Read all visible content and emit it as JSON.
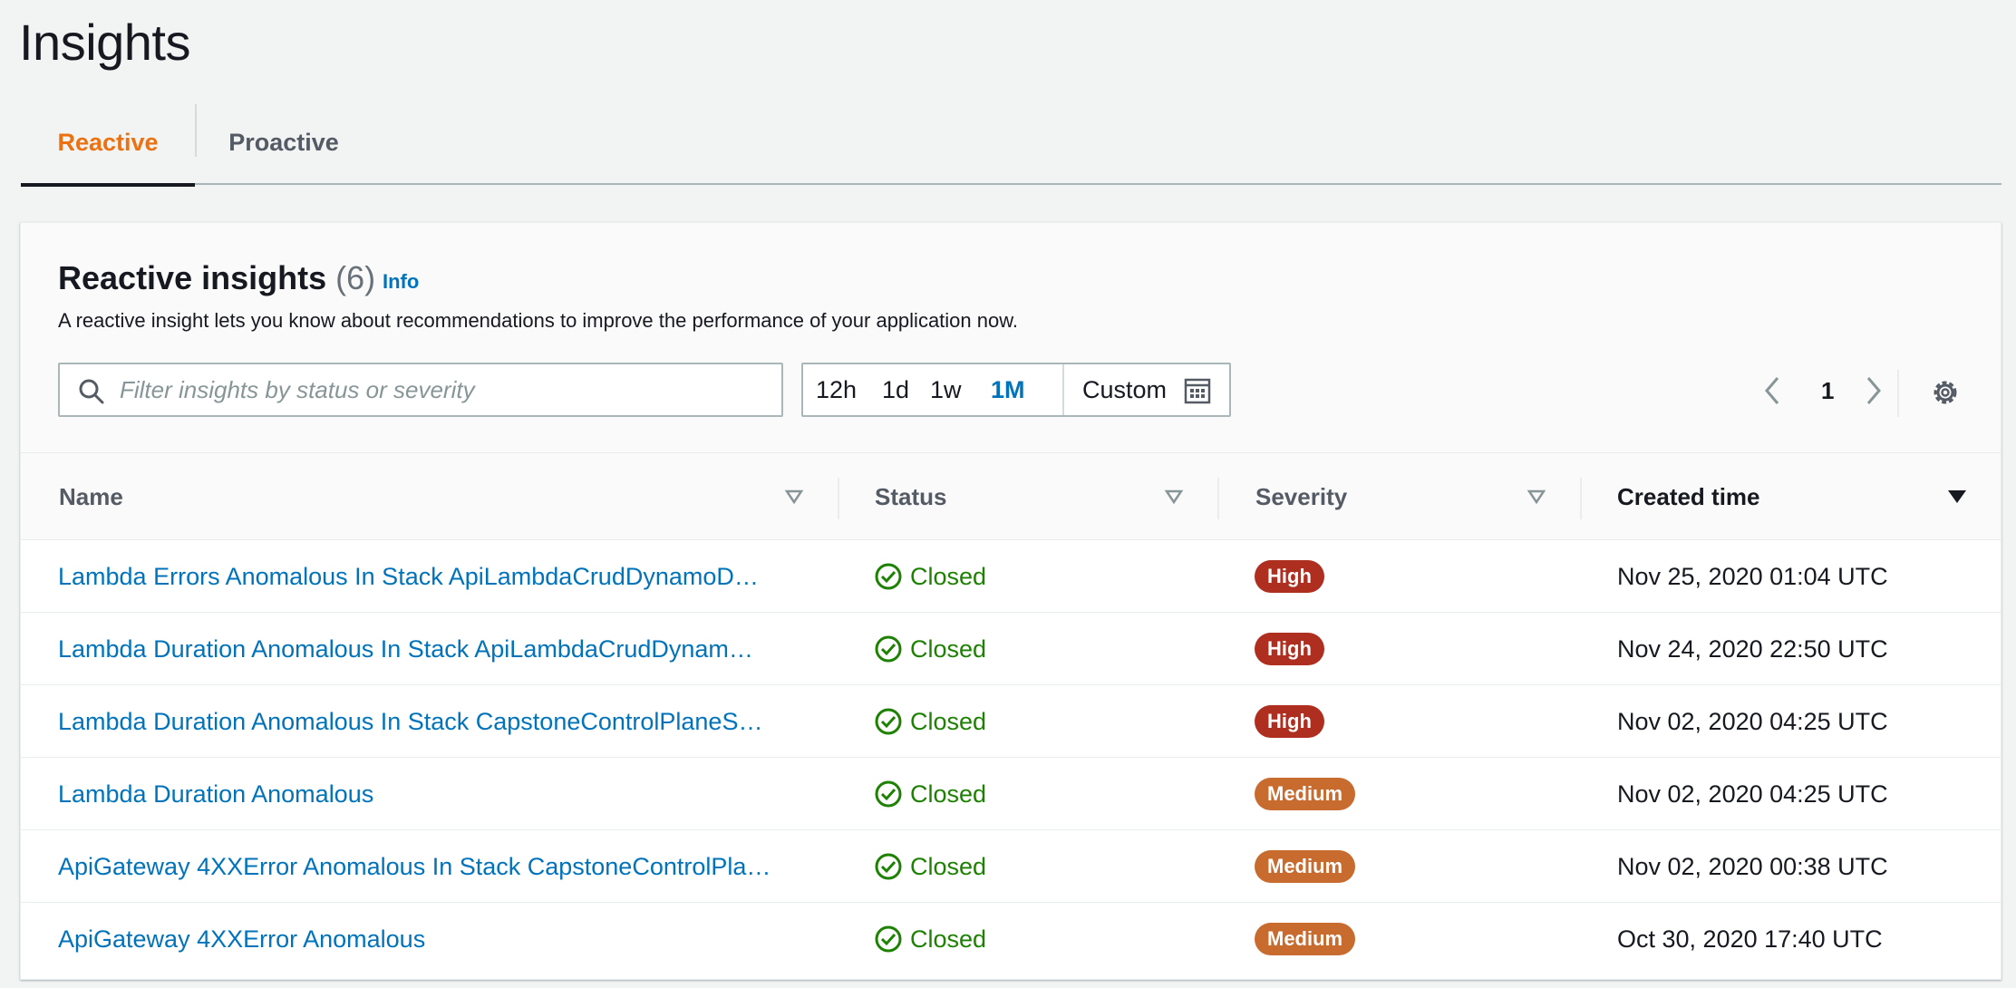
{
  "page": {
    "title": "Insights"
  },
  "tabs": [
    {
      "label": "Reactive",
      "active": true
    },
    {
      "label": "Proactive",
      "active": false
    }
  ],
  "panel": {
    "title": "Reactive insights",
    "count": "(6)",
    "info_label": "Info",
    "description": "A reactive insight lets you know about recommendations to improve the performance of your application now."
  },
  "search": {
    "placeholder": "Filter insights by status or severity",
    "value": ""
  },
  "range": {
    "options": [
      "12h",
      "1d",
      "1w",
      "1M"
    ],
    "selected": "1M",
    "custom_label": "Custom"
  },
  "pagination": {
    "current_page": "1"
  },
  "columns": {
    "name": "Name",
    "status": "Status",
    "severity": "Severity",
    "created": "Created time"
  },
  "rows": [
    {
      "name": "Lambda Errors Anomalous In Stack ApiLambdaCrudDynamoD…",
      "status": "Closed",
      "severity": "High",
      "created": "Nov 25, 2020 01:04 UTC"
    },
    {
      "name": "Lambda Duration Anomalous In Stack ApiLambdaCrudDynam…",
      "status": "Closed",
      "severity": "High",
      "created": "Nov 24, 2020 22:50 UTC"
    },
    {
      "name": "Lambda Duration Anomalous In Stack CapstoneControlPlaneS…",
      "status": "Closed",
      "severity": "High",
      "created": "Nov 02, 2020 04:25 UTC"
    },
    {
      "name": "Lambda Duration Anomalous",
      "status": "Closed",
      "severity": "Medium",
      "created": "Nov 02, 2020 04:25 UTC"
    },
    {
      "name": "ApiGateway 4XXError Anomalous In Stack CapstoneControlPla…",
      "status": "Closed",
      "severity": "Medium",
      "created": "Nov 02, 2020 00:38 UTC"
    },
    {
      "name": "ApiGateway 4XXError Anomalous",
      "status": "Closed",
      "severity": "Medium",
      "created": "Oct 30, 2020 17:40 UTC"
    }
  ],
  "colors": {
    "accent_tab": "#ec7211",
    "link": "#0073bb",
    "status_closed": "#1d8102",
    "severity_high": "#ae2f20",
    "severity_medium": "#c86b2f"
  },
  "icons": {
    "search": "search-icon",
    "calendar": "calendar-icon",
    "prev": "chevron-left-icon",
    "next": "chevron-right-icon",
    "settings": "gear-icon",
    "sort": "sort-caret-icon",
    "status": "check-circle-icon"
  }
}
